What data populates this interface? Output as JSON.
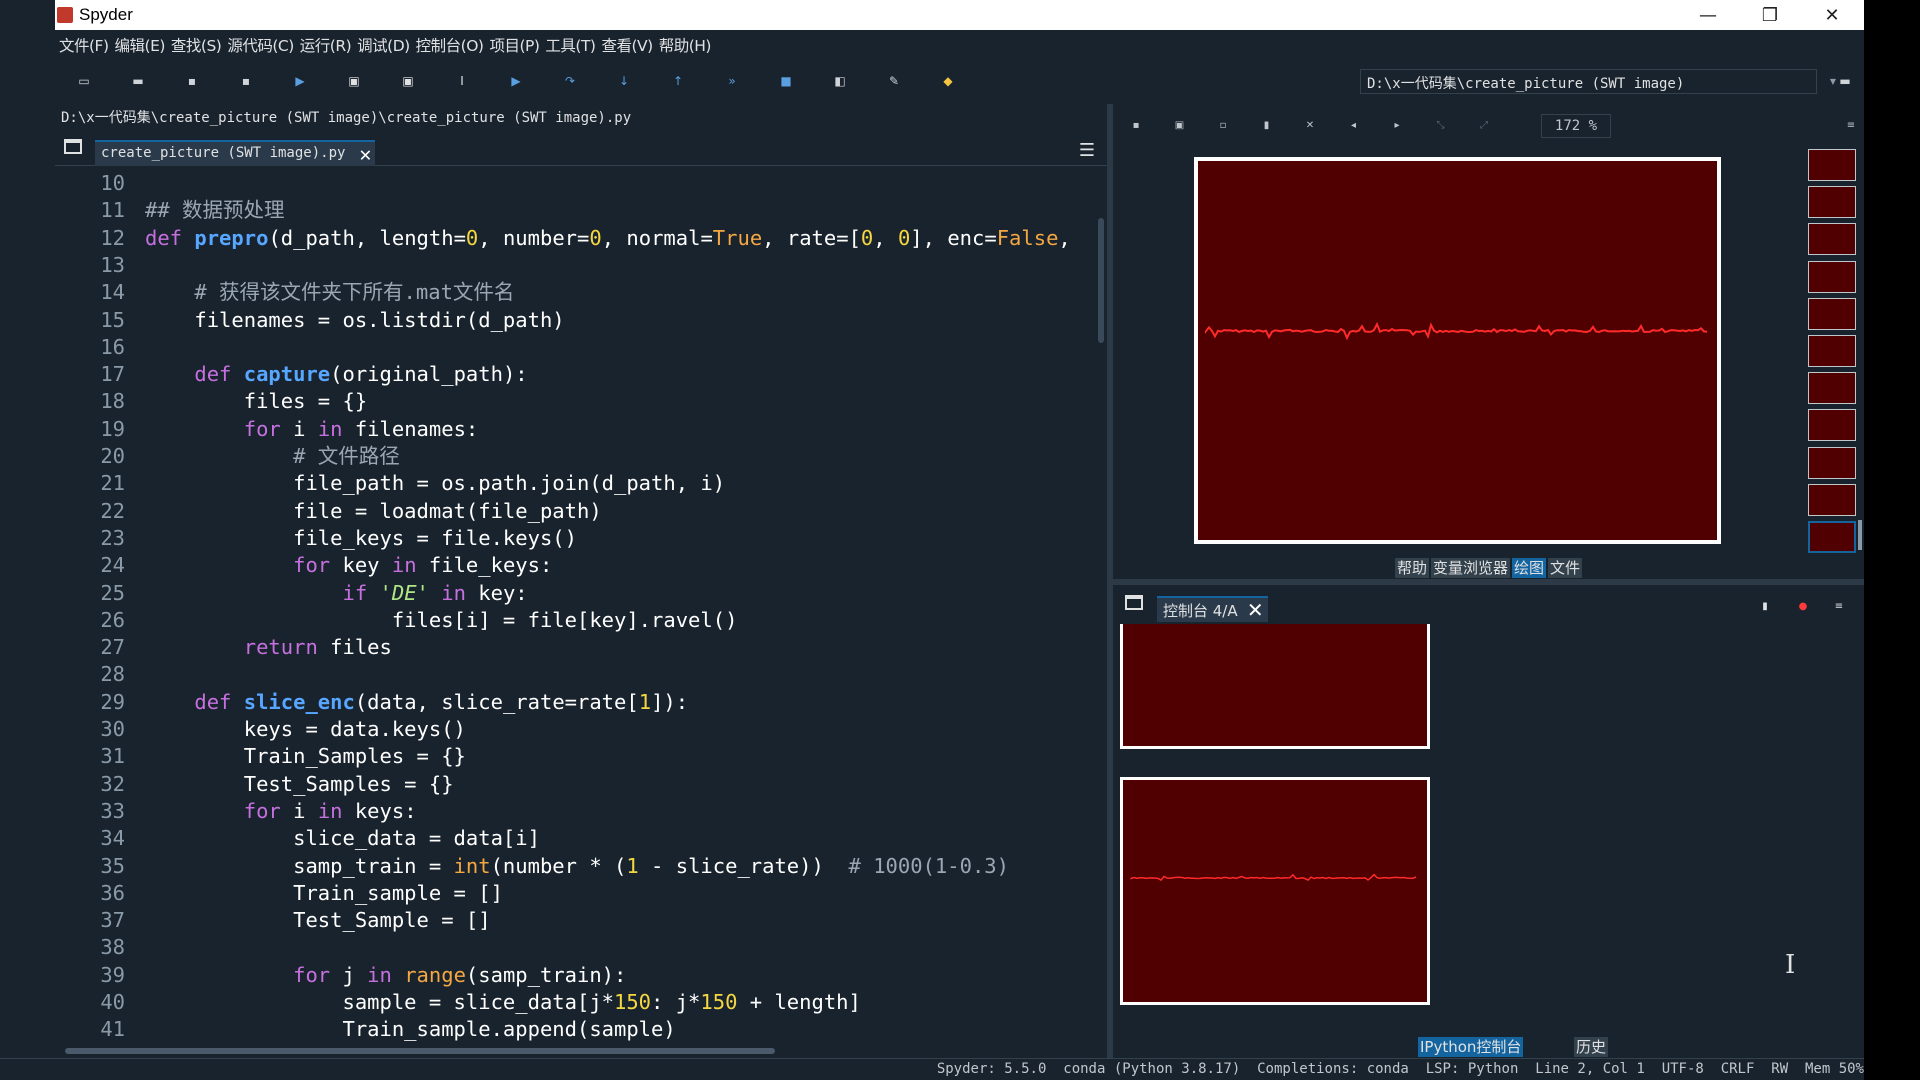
{
  "window": {
    "title": "Spyder",
    "minimize": "—",
    "restore": "❐",
    "close": "✕"
  },
  "menu": [
    "文件(F)",
    "编辑(E)",
    "查找(S)",
    "源代码(C)",
    "运行(R)",
    "调试(D)",
    "控制台(O)",
    "项目(P)",
    "工具(T)",
    "查看(V)",
    "帮助(H)"
  ],
  "toolbar": {
    "icons": [
      "new-file-icon",
      "open-file-icon",
      "save-icon",
      "save-all-icon",
      "run-icon",
      "run-cell-icon",
      "run-cell-advance-icon",
      "run-selection-icon",
      "debug-icon",
      "step-icon",
      "step-into-icon",
      "step-return-icon",
      "continue-icon",
      "stop-icon",
      "maximize-pane-icon",
      "preferences-icon",
      "python-path-icon"
    ],
    "working_dir": "D:\\x一代码集\\create_picture (SWT image)"
  },
  "editor": {
    "file_path": "D:\\x一代码集\\create_picture (SWT image)\\create_picture (SWT image).py",
    "tab_label": "create_picture (SWT image).py",
    "lines": [
      {
        "n": "10",
        "segs": []
      },
      {
        "n": "11",
        "segs": [
          {
            "t": "## 数据预处理",
            "c": "cm"
          }
        ]
      },
      {
        "n": "12",
        "segs": [
          {
            "t": "def ",
            "c": "kw"
          },
          {
            "t": "prepro",
            "c": "fn"
          },
          {
            "t": "(d_path, length=",
            "c": ""
          },
          {
            "t": "0",
            "c": "num"
          },
          {
            "t": ", number=",
            "c": ""
          },
          {
            "t": "0",
            "c": "num"
          },
          {
            "t": ", normal=",
            "c": ""
          },
          {
            "t": "True",
            "c": "bi"
          },
          {
            "t": ", rate=[",
            "c": ""
          },
          {
            "t": "0",
            "c": "num"
          },
          {
            "t": ", ",
            "c": ""
          },
          {
            "t": "0",
            "c": "num"
          },
          {
            "t": "], enc=",
            "c": ""
          },
          {
            "t": "False",
            "c": "bi"
          },
          {
            "t": ", ",
            "c": ""
          }
        ]
      },
      {
        "n": "13",
        "segs": []
      },
      {
        "n": "14",
        "segs": [
          {
            "t": "    # 获得该文件夹下所有.mat文件名",
            "c": "cm"
          }
        ]
      },
      {
        "n": "15",
        "segs": [
          {
            "t": "    filenames = os.listdir(d_path)",
            "c": ""
          }
        ]
      },
      {
        "n": "16",
        "segs": []
      },
      {
        "n": "17",
        "segs": [
          {
            "t": "    ",
            "c": ""
          },
          {
            "t": "def ",
            "c": "kw"
          },
          {
            "t": "capture",
            "c": "fn"
          },
          {
            "t": "(original_path):",
            "c": ""
          }
        ]
      },
      {
        "n": "18",
        "segs": [
          {
            "t": "        files = {}",
            "c": ""
          }
        ]
      },
      {
        "n": "19",
        "segs": [
          {
            "t": "        ",
            "c": ""
          },
          {
            "t": "for",
            "c": "kw"
          },
          {
            "t": " i ",
            "c": ""
          },
          {
            "t": "in",
            "c": "kw"
          },
          {
            "t": " filenames:",
            "c": ""
          }
        ]
      },
      {
        "n": "20",
        "segs": [
          {
            "t": "            # 文件路径",
            "c": "cm"
          }
        ]
      },
      {
        "n": "21",
        "segs": [
          {
            "t": "            file_path = os.path.join(d_path, i)",
            "c": ""
          }
        ]
      },
      {
        "n": "22",
        "segs": [
          {
            "t": "            file = loadmat(file_path)",
            "c": ""
          }
        ]
      },
      {
        "n": "23",
        "segs": [
          {
            "t": "            file_keys = file.keys()",
            "c": ""
          }
        ]
      },
      {
        "n": "24",
        "segs": [
          {
            "t": "            ",
            "c": ""
          },
          {
            "t": "for",
            "c": "kw"
          },
          {
            "t": " key ",
            "c": ""
          },
          {
            "t": "in",
            "c": "kw"
          },
          {
            "t": " file_keys:",
            "c": ""
          }
        ]
      },
      {
        "n": "25",
        "segs": [
          {
            "t": "                ",
            "c": ""
          },
          {
            "t": "if",
            "c": "kw"
          },
          {
            "t": " ",
            "c": ""
          },
          {
            "t": "'DE'",
            "c": "str"
          },
          {
            "t": " ",
            "c": ""
          },
          {
            "t": "in",
            "c": "kw"
          },
          {
            "t": " key:",
            "c": ""
          }
        ]
      },
      {
        "n": "26",
        "segs": [
          {
            "t": "                    files[i] = file[key].ravel()",
            "c": ""
          }
        ]
      },
      {
        "n": "27",
        "segs": [
          {
            "t": "        ",
            "c": ""
          },
          {
            "t": "return",
            "c": "kw"
          },
          {
            "t": " files",
            "c": ""
          }
        ]
      },
      {
        "n": "28",
        "segs": []
      },
      {
        "n": "29",
        "segs": [
          {
            "t": "    ",
            "c": ""
          },
          {
            "t": "def ",
            "c": "kw"
          },
          {
            "t": "slice_enc",
            "c": "fn"
          },
          {
            "t": "(data, slice_rate=rate[",
            "c": ""
          },
          {
            "t": "1",
            "c": "num"
          },
          {
            "t": "]):",
            "c": ""
          }
        ]
      },
      {
        "n": "30",
        "segs": [
          {
            "t": "        keys = data.keys()",
            "c": ""
          }
        ]
      },
      {
        "n": "31",
        "segs": [
          {
            "t": "        Train_Samples = {}",
            "c": ""
          }
        ]
      },
      {
        "n": "32",
        "segs": [
          {
            "t": "        Test_Samples = {}",
            "c": ""
          }
        ]
      },
      {
        "n": "33",
        "segs": [
          {
            "t": "        ",
            "c": ""
          },
          {
            "t": "for",
            "c": "kw"
          },
          {
            "t": " i ",
            "c": ""
          },
          {
            "t": "in",
            "c": "kw"
          },
          {
            "t": " keys:",
            "c": ""
          }
        ]
      },
      {
        "n": "34",
        "segs": [
          {
            "t": "            slice_data = data[i]",
            "c": ""
          }
        ]
      },
      {
        "n": "35",
        "segs": [
          {
            "t": "            samp_train = ",
            "c": ""
          },
          {
            "t": "int",
            "c": "bi"
          },
          {
            "t": "(number * (",
            "c": ""
          },
          {
            "t": "1",
            "c": "num"
          },
          {
            "t": " - slice_rate))  ",
            "c": ""
          },
          {
            "t": "# 1000(1-0.3)",
            "c": "cm"
          }
        ]
      },
      {
        "n": "36",
        "segs": [
          {
            "t": "            Train_sample = []",
            "c": ""
          }
        ]
      },
      {
        "n": "37",
        "segs": [
          {
            "t": "            Test_Sample = []",
            "c": ""
          }
        ]
      },
      {
        "n": "38",
        "segs": []
      },
      {
        "n": "39",
        "segs": [
          {
            "t": "            ",
            "c": ""
          },
          {
            "t": "for",
            "c": "kw"
          },
          {
            "t": " j ",
            "c": ""
          },
          {
            "t": "in",
            "c": "kw"
          },
          {
            "t": " ",
            "c": ""
          },
          {
            "t": "range",
            "c": "bi"
          },
          {
            "t": "(samp_train):",
            "c": ""
          }
        ]
      },
      {
        "n": "40",
        "segs": [
          {
            "t": "                sample = slice_data[j*",
            "c": ""
          },
          {
            "t": "150",
            "c": "num"
          },
          {
            "t": ": j*",
            "c": ""
          },
          {
            "t": "150",
            "c": "num"
          },
          {
            "t": " + length]",
            "c": ""
          }
        ]
      },
      {
        "n": "41",
        "segs": [
          {
            "t": "                Train_sample.append(sample)",
            "c": ""
          }
        ]
      }
    ]
  },
  "plots": {
    "zoom": "172 %",
    "tabs": [
      "帮助",
      "变量浏览器",
      "绘图",
      "文件"
    ],
    "active_tab": 2,
    "thumbnail_count": 11,
    "colors": {
      "background": "#500000",
      "signal": "#ff2a2a",
      "frame": "#ffffff"
    }
  },
  "console": {
    "tab_label": "控制台 4/A",
    "tabs": [
      "IPython控制台",
      "历史"
    ],
    "active_tab": 0
  },
  "status": "Spyder: 5.5.0  conda (Python 3.8.17)  Completions: conda  LSP: Python  Line 2, Col 1  UTF-8  CRLF  RW  Mem 50%"
}
